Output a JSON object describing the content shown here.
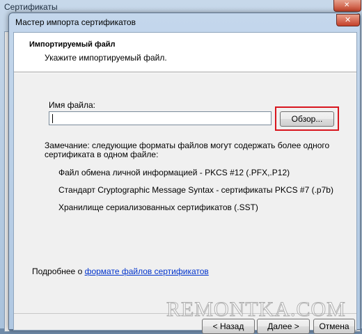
{
  "background_window": {
    "title": "Сертификаты"
  },
  "dialog": {
    "title": "Мастер импорта сертификатов",
    "header": {
      "title": "Импортируемый файл",
      "subtitle": "Укажите импортируемый файл."
    },
    "file": {
      "label": "Имя файла:",
      "value": "",
      "browse_label": "Обзор..."
    },
    "note": "Замечание: следующие форматы файлов могут содержать более одного сертификата в одном файле:",
    "formats": [
      "Файл обмена личной информацией - PKCS #12 (.PFX,.P12)",
      "Стандарт Cryptographic Message Syntax - сертификаты PKCS #7 (.p7b)",
      "Хранилище сериализованных сертификатов (.SST)"
    ],
    "more_info": {
      "prefix": "Подробнее о ",
      "link": "формате файлов сертификатов"
    },
    "buttons": {
      "back": "< Назад",
      "next": "Далее >",
      "cancel": "Отмена"
    }
  },
  "colors": {
    "highlight": "#d8151d",
    "link": "#0033cc"
  },
  "watermark": "REMONTKA.COM"
}
